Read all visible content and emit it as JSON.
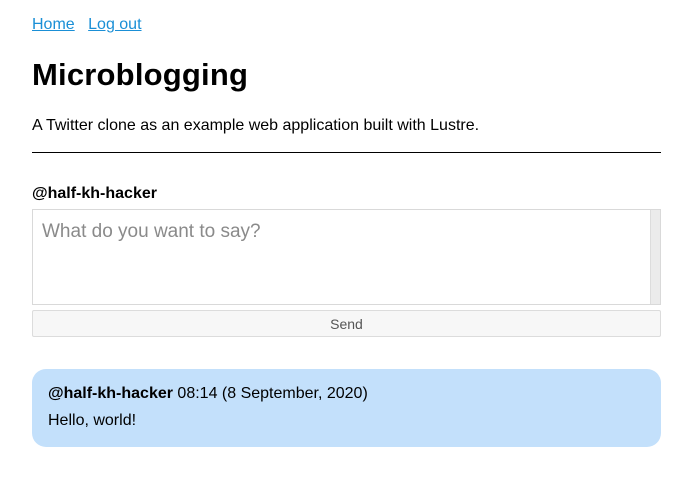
{
  "nav": {
    "home_label": "Home",
    "logout_label": "Log out"
  },
  "header": {
    "title": "Microblogging",
    "tagline": "A Twitter clone as an example web application built with Lustre."
  },
  "composer": {
    "handle": "@half-kh-hacker",
    "placeholder": "What do you want to say?",
    "value": "",
    "send_label": "Send"
  },
  "feed": {
    "posts": [
      {
        "author": "@half-kh-hacker",
        "timestamp": "08:14 (8 September, 2020)",
        "body": "Hello, world!"
      }
    ]
  },
  "colors": {
    "link": "#1a8fd6",
    "post_card_bg": "#c3e0fb",
    "button_bg": "#f7f7f7"
  }
}
